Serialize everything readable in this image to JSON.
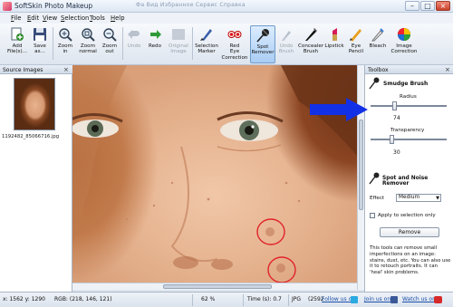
{
  "window": {
    "title": "SoftSkin Photo Makeup",
    "ghost_menu": "Фа  Вид  Избранное  Сервис  Справка"
  },
  "menu": [
    "File",
    "Edit",
    "View",
    "Selection",
    "Tools",
    "Help"
  ],
  "menu_underline": [
    "F",
    "E",
    "V",
    "S",
    "T",
    "H"
  ],
  "toolbar": [
    {
      "label": "Add\nFile(s)...",
      "icon": "add-file-icon",
      "enabled": true
    },
    {
      "label": "Save\nas...",
      "icon": "save-icon",
      "enabled": true
    },
    {
      "label": "Zoom\nin",
      "icon": "zoom-in-icon",
      "enabled": true
    },
    {
      "label": "Zoom\nnormal",
      "icon": "zoom-normal-icon",
      "enabled": true
    },
    {
      "label": "Zoom\nout",
      "icon": "zoom-out-icon",
      "enabled": true
    },
    {
      "label": "Undo",
      "icon": "undo-icon",
      "enabled": false
    },
    {
      "label": "Redo",
      "icon": "redo-icon",
      "enabled": true
    },
    {
      "label": "Original\nImage",
      "icon": "original-image-icon",
      "enabled": false
    },
    {
      "label": "Selection\nMarker",
      "icon": "selection-marker-icon",
      "enabled": true
    },
    {
      "label": "Red\nEye\nCorrection",
      "icon": "red-eye-icon",
      "enabled": true
    },
    {
      "label": "Spot\nRemover",
      "icon": "spot-remover-icon",
      "enabled": true,
      "active": true
    },
    {
      "label": "Undo\nBrush",
      "icon": "undo-brush-icon",
      "enabled": false
    },
    {
      "label": "Concealer\nBrush",
      "icon": "concealer-brush-icon",
      "enabled": true
    },
    {
      "label": "Lipstick",
      "icon": "lipstick-icon",
      "enabled": true
    },
    {
      "label": "Eye\nPencil",
      "icon": "eye-pencil-icon",
      "enabled": true
    },
    {
      "label": "Bleach",
      "icon": "bleach-icon",
      "enabled": true
    },
    {
      "label": "Image\nCorrection",
      "icon": "image-correction-icon",
      "enabled": true
    }
  ],
  "source_panel": {
    "title": "Source Images",
    "file_name": "1192482_85066716.jpg"
  },
  "toolbox": {
    "title": "Toolbox",
    "smudge_title": "Smudge Brush",
    "radius_label": "Radius",
    "radius_value": "74",
    "transparency_label": "Transparency",
    "transparency_value": "30",
    "spot_title": "Spot and Noise Remover",
    "effect_label": "Effect",
    "effect_value": "Medium",
    "apply_label": "Apply to selection only",
    "remove_label": "Remove",
    "description": "This tools can remove small imperfections on an image: stains, dust, etc. You can also use it to retouch portraits. It can 'heal' skin problems."
  },
  "status": {
    "coords": "x: 1562 y: 1290",
    "rgb": "RGB: (218, 146, 121)",
    "zoom": "62 %",
    "time": "Time (s): 0.7",
    "format": "JPG",
    "dimensions": "(2592",
    "follow": "Follow us on",
    "join": "Join us on",
    "watch": "Watch us on"
  },
  "colors": {
    "arrow": "#1230e6",
    "circle": "#e0242b",
    "active_tool": "#a9cdf3"
  }
}
